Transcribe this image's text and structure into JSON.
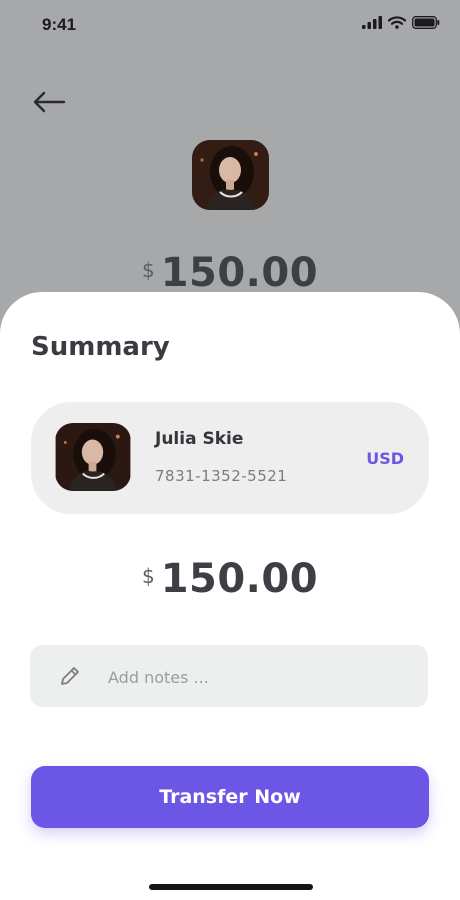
{
  "status_bar": {
    "time": "9:41"
  },
  "payment": {
    "currency_symbol": "$",
    "amount": "150.00"
  },
  "summary": {
    "title": "Summary",
    "recipient": {
      "name": "Julia Skie",
      "account": "7831-1352-5521",
      "currency": "USD"
    }
  },
  "notes": {
    "placeholder": "Add notes ..."
  },
  "actions": {
    "transfer_label": "Transfer Now"
  },
  "icons": [
    "back-arrow-icon",
    "signal-icon",
    "wifi-icon",
    "battery-icon",
    "pencil-icon"
  ],
  "colors": {
    "accent": "#6b56e6",
    "overlay": "#a7a8aa",
    "card": "#eeeeef"
  }
}
